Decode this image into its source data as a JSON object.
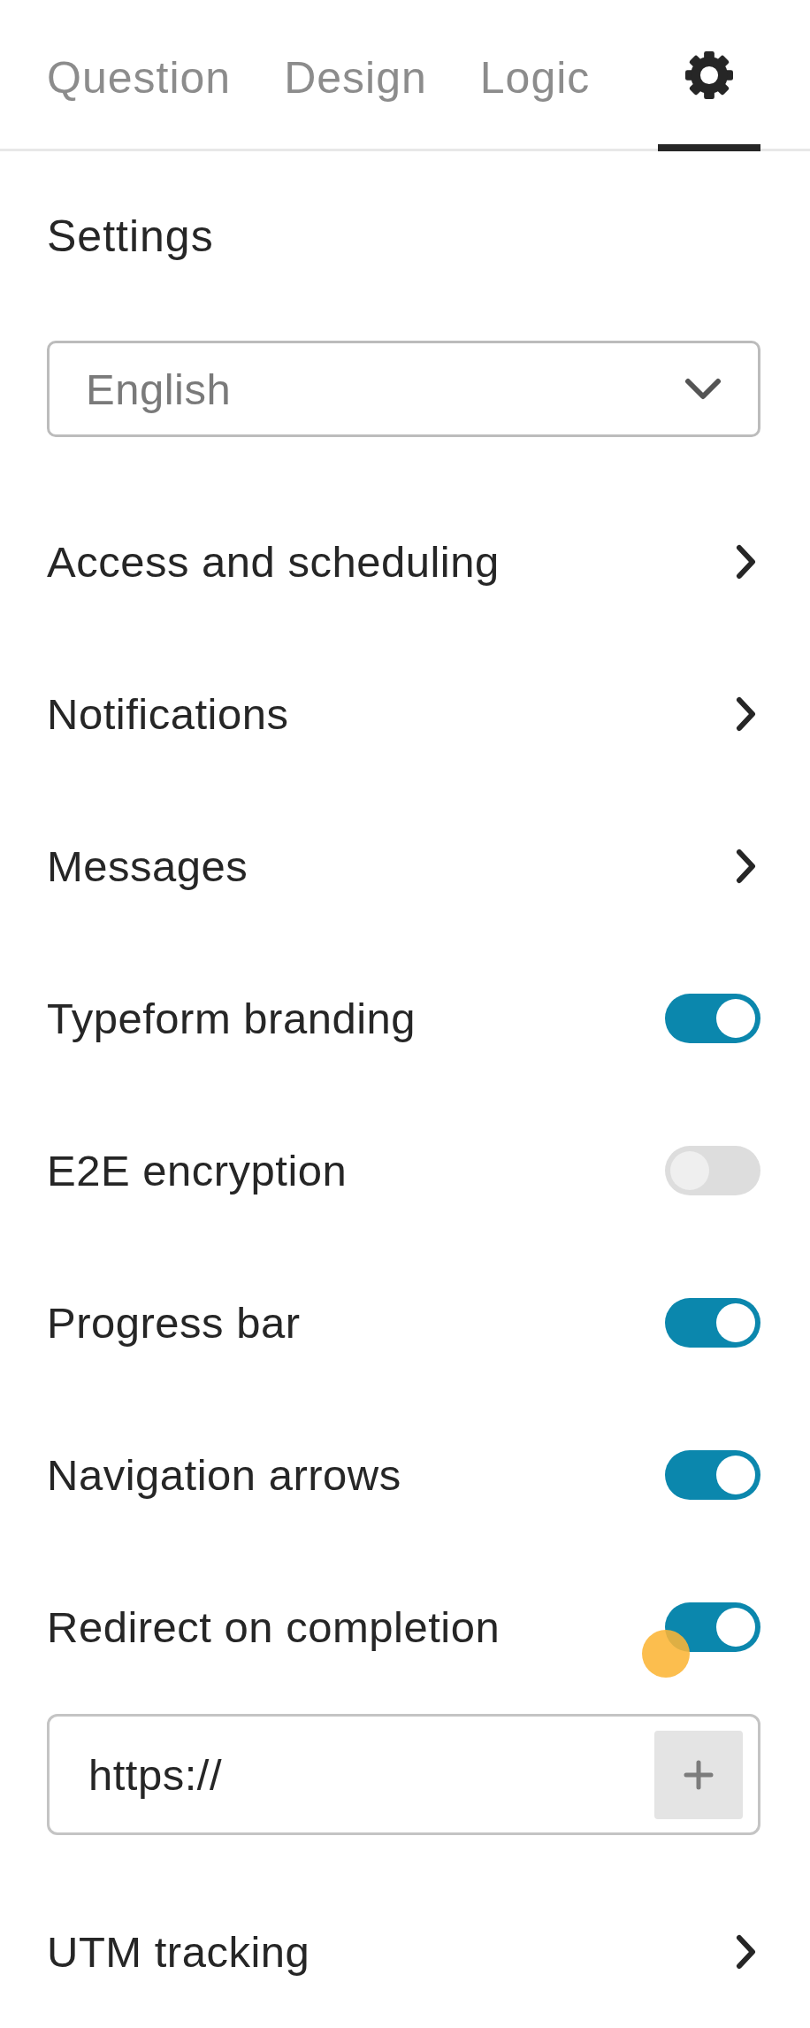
{
  "tabs": [
    {
      "kind": "text",
      "label": "Question",
      "selected": false
    },
    {
      "kind": "text",
      "label": "Design",
      "selected": false
    },
    {
      "kind": "text",
      "label": "Logic",
      "selected": false
    },
    {
      "kind": "icon",
      "selected": true
    }
  ],
  "settings": {
    "title": "Settings",
    "language_select": {
      "value": "English"
    },
    "items": [
      {
        "kind": "link",
        "label": "Access and scheduling",
        "tapped": false
      },
      {
        "kind": "link",
        "label": "Notifications",
        "tapped": false
      },
      {
        "kind": "link",
        "label": "Messages",
        "tapped": false
      },
      {
        "kind": "toggle",
        "label": "Typeform branding",
        "on": true,
        "tapped": false
      },
      {
        "kind": "toggle",
        "label": "E2E encryption",
        "on": false,
        "tapped": false
      },
      {
        "kind": "toggle",
        "label": "Progress bar",
        "on": true,
        "tapped": false
      },
      {
        "kind": "toggle",
        "label": "Navigation arrows",
        "on": true,
        "tapped": false
      },
      {
        "kind": "toggle",
        "label": "Redirect on completion",
        "on": true,
        "tapped": true,
        "url_field": {
          "value": "https://"
        }
      },
      {
        "kind": "link",
        "label": "UTM tracking",
        "tapped": false
      }
    ]
  }
}
